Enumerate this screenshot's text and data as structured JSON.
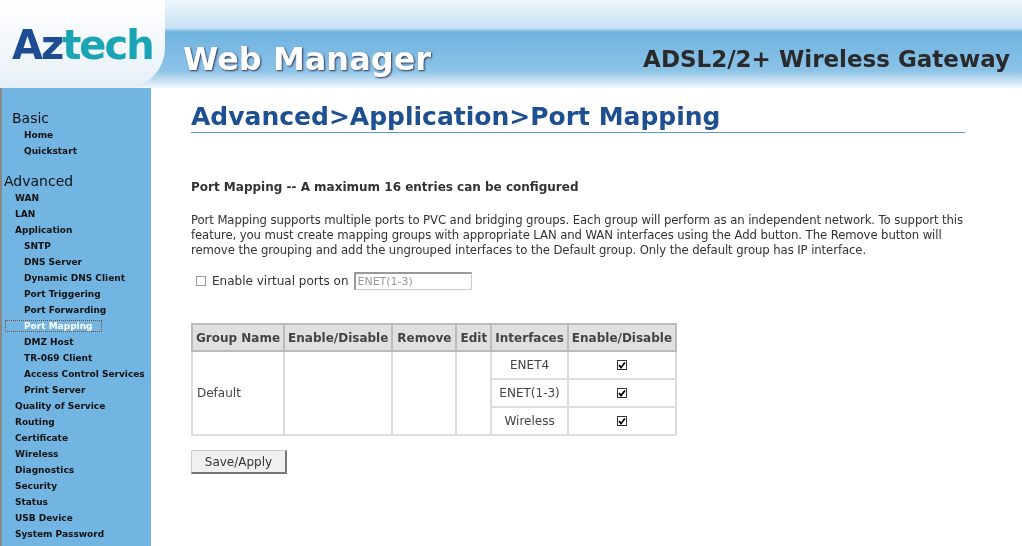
{
  "header": {
    "logo": [
      {
        "text": "Az",
        "color": "#1d4c93"
      },
      {
        "text": "tech",
        "color": "#1ba4b4"
      }
    ],
    "title": "Web Manager",
    "product": "ADSL2/2+ Wireless Gateway"
  },
  "sidebar": [
    {
      "label": "Basic",
      "children": [
        {
          "label": "Home",
          "selected": false
        },
        {
          "label": "Quickstart",
          "selected": false
        }
      ]
    },
    {
      "label": "Advanced",
      "children": [
        {
          "label": "WAN",
          "selected": false
        },
        {
          "label": "LAN",
          "selected": false
        },
        {
          "label": "Application",
          "selected": false,
          "children": [
            {
              "label": "SNTP",
              "selected": false
            },
            {
              "label": "DNS Server",
              "selected": false
            },
            {
              "label": "Dynamic DNS Client",
              "selected": false
            },
            {
              "label": "Port Triggering",
              "selected": false
            },
            {
              "label": "Port Forwarding",
              "selected": false
            },
            {
              "label": "Port Mapping",
              "selected": true
            },
            {
              "label": "DMZ Host",
              "selected": false
            },
            {
              "label": "TR-069 Client",
              "selected": false
            },
            {
              "label": "Access Control Services",
              "selected": false
            },
            {
              "label": "Print Server",
              "selected": false
            }
          ]
        },
        {
          "label": "Quality of Service",
          "selected": false
        },
        {
          "label": "Routing",
          "selected": false
        },
        {
          "label": "Certificate",
          "selected": false
        },
        {
          "label": "Wireless",
          "selected": false
        },
        {
          "label": "Diagnostics",
          "selected": false
        },
        {
          "label": "Security",
          "selected": false
        },
        {
          "label": "Status",
          "selected": false
        },
        {
          "label": "USB Device",
          "selected": false
        },
        {
          "label": "System Password",
          "selected": false
        }
      ]
    }
  ],
  "page_title": "Advanced>Application>Port Mapping",
  "subtitle": "Port Mapping -- A maximum 16 entries can be configured",
  "description": "Port Mapping supports multiple ports to PVC and bridging groups. Each group will perform as an independent network. To support this feature, you must create mapping groups with appropriate LAN and WAN interfaces using the Add button. The Remove button will remove the grouping and add the ungrouped interfaces to the Default group. Only the default group has IP interface.",
  "virtual_ports": {
    "label": "Enable virtual ports on",
    "checked": false,
    "value": "ENET(1-3)"
  },
  "table": {
    "columns": [
      "Group Name",
      "Enable/Disable",
      "Remove",
      "Edit",
      "Interfaces",
      "Enable/Disable"
    ],
    "groups": [
      {
        "name": "Default",
        "interfaces": [
          {
            "name": "ENET4",
            "checked": true
          },
          {
            "name": "ENET(1-3)",
            "checked": true
          },
          {
            "name": "Wireless",
            "checked": true
          }
        ]
      }
    ]
  },
  "buttons": [
    "Save/Apply"
  ]
}
